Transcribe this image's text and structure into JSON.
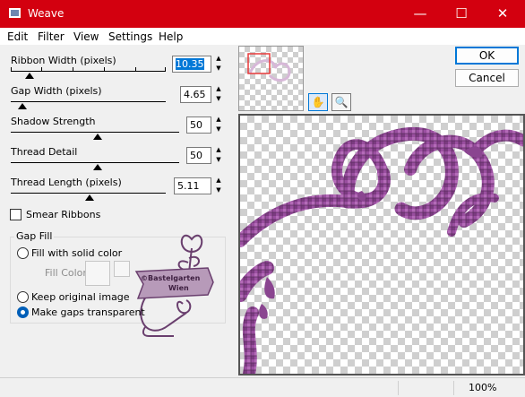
{
  "window": {
    "title": "Weave"
  },
  "title_buttons": {
    "minimize": "—",
    "maximize": "☐",
    "close": "✕"
  },
  "menu": [
    "Edit",
    "Filter",
    "View",
    "Settings",
    "Help"
  ],
  "controls": {
    "ribbon_width": {
      "label": "Ribbon Width (pixels)",
      "value": "10.35",
      "level": 0.2
    },
    "gap_width": {
      "label": "Gap Width (pixels)",
      "value": "4.65",
      "level": 0.08
    },
    "shadow_strength": {
      "label": "Shadow Strength",
      "value": "50",
      "level": 0.5
    },
    "thread_detail": {
      "label": "Thread Detail",
      "value": "50",
      "level": 0.5
    },
    "thread_length": {
      "label": "Thread Length (pixels)",
      "value": "5.11",
      "level": 0.5
    }
  },
  "smear": {
    "label": "Smear Ribbons",
    "checked": false
  },
  "gap_fill": {
    "title": "Gap Fill",
    "options": [
      "Fill with solid color",
      "Keep original image",
      "Make gaps transparent"
    ],
    "selected": "Make gaps transparent",
    "fill_color_label": "Fill Color"
  },
  "watermark": {
    "line1": "©Bastelgarten",
    "line2": "Wien"
  },
  "buttons": {
    "ok": "OK",
    "cancel": "Cancel"
  },
  "tools": {
    "pan": "✋",
    "zoom": "🔍"
  },
  "status": {
    "zoom": "100%"
  },
  "colors": {
    "title_bar": "#d3000f",
    "selection": "#0078d7",
    "ribbon_purple": "#9a4fa0"
  }
}
